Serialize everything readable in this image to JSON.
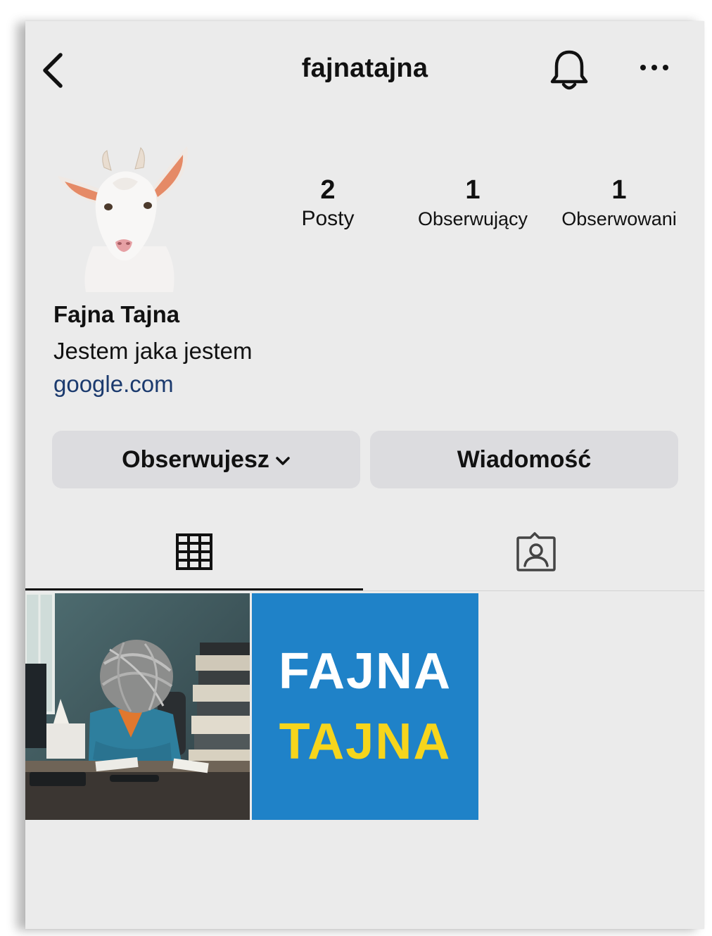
{
  "header": {
    "username": "fajnatajna",
    "back_icon": "chevron-left-icon",
    "bell_icon": "bell-icon",
    "more_icon": "ellipsis-icon"
  },
  "profile": {
    "avatar": "goat-avatar",
    "display_name": "Fajna Tajna",
    "bio": "Jestem jaka jestem",
    "link": "google.com",
    "link_color": "#1b3a6e"
  },
  "stats": {
    "posts": {
      "value": "2",
      "label": "Posty"
    },
    "followers": {
      "value": "1",
      "label": "Obserwujący"
    },
    "following": {
      "value": "1",
      "label": "Obserwowani"
    }
  },
  "actions": {
    "follow_label": "Obserwujesz",
    "message_label": "Wiadomość"
  },
  "tabs": {
    "grid_icon": "grid-icon",
    "tagged_icon": "tagged-person-icon",
    "active": "grid"
  },
  "posts": [
    {
      "kind": "photo",
      "description_icon": "office-illustration"
    },
    {
      "kind": "text-graphic",
      "line1": "FAJNA",
      "line2": "TAJNA",
      "bg_color": "#1f82c8",
      "line2_color": "#f6d51c"
    }
  ]
}
